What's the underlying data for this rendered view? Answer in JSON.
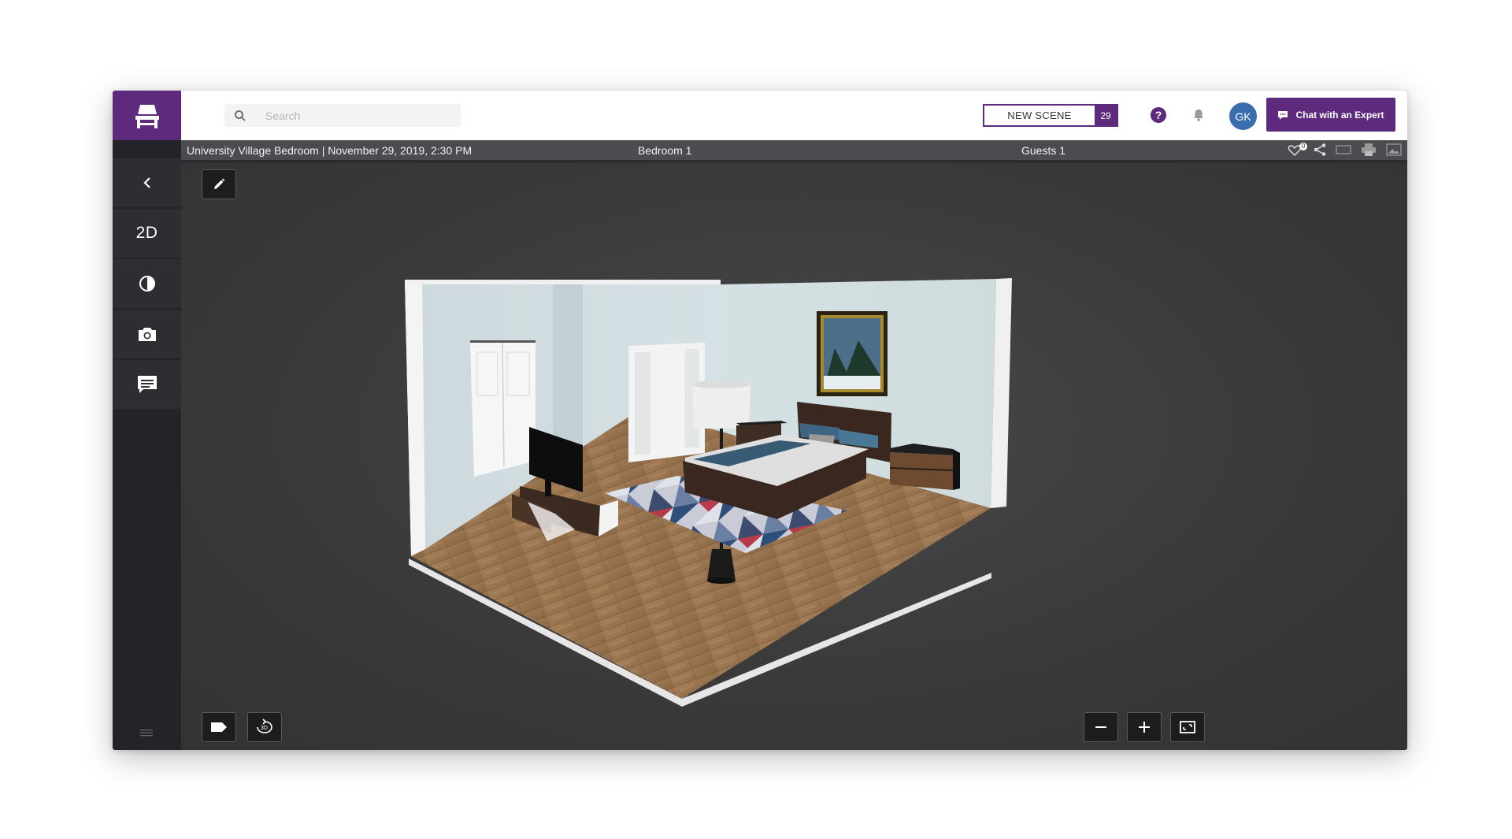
{
  "brand": {
    "accent": "#5e2a7e",
    "logo_icon": "chair-icon"
  },
  "search": {
    "placeholder": "Search"
  },
  "header": {
    "new_scene_label": "NEW SCENE",
    "new_scene_count": "29",
    "help_label": "?",
    "avatar_initials": "GK",
    "chat_label": "Chat with an Expert"
  },
  "infobar": {
    "scene_title": "University Village Bedroom | November 29, 2019, 2:30 PM",
    "room_name": "Bedroom 1",
    "guests": "Guests 1",
    "likes_count": "0"
  },
  "sidebar": {
    "items": [
      {
        "name": "back",
        "icon": "chevron-left-icon"
      },
      {
        "name": "2d-toggle",
        "label": "2D"
      },
      {
        "name": "contrast",
        "icon": "contrast-icon"
      },
      {
        "name": "camera",
        "icon": "camera-icon"
      },
      {
        "name": "comments",
        "icon": "comment-icon"
      }
    ]
  },
  "viewport": {
    "tools": [
      "pencil-icon",
      "tag-icon",
      "rotate-3d-icon",
      "zoom-out-icon",
      "zoom-in-icon",
      "fit-screen-icon"
    ],
    "rotate_label": "3D"
  }
}
